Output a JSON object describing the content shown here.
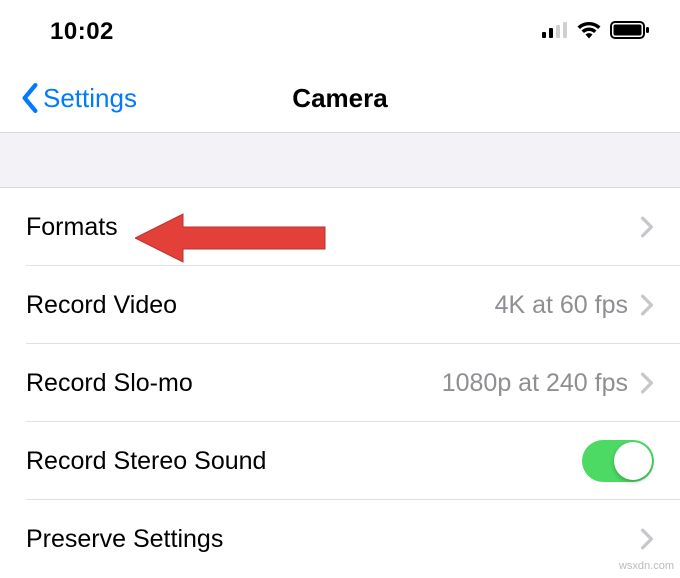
{
  "status": {
    "time": "10:02"
  },
  "nav": {
    "back_label": "Settings",
    "title": "Camera"
  },
  "rows": {
    "formats": {
      "label": "Formats"
    },
    "record_video": {
      "label": "Record Video",
      "detail": "4K at 60 fps"
    },
    "record_slomo": {
      "label": "Record Slo-mo",
      "detail": "1080p at 240 fps"
    },
    "record_stereo": {
      "label": "Record Stereo Sound",
      "toggle": true
    },
    "preserve": {
      "label": "Preserve Settings"
    }
  },
  "watermark": "wsxdn.com"
}
